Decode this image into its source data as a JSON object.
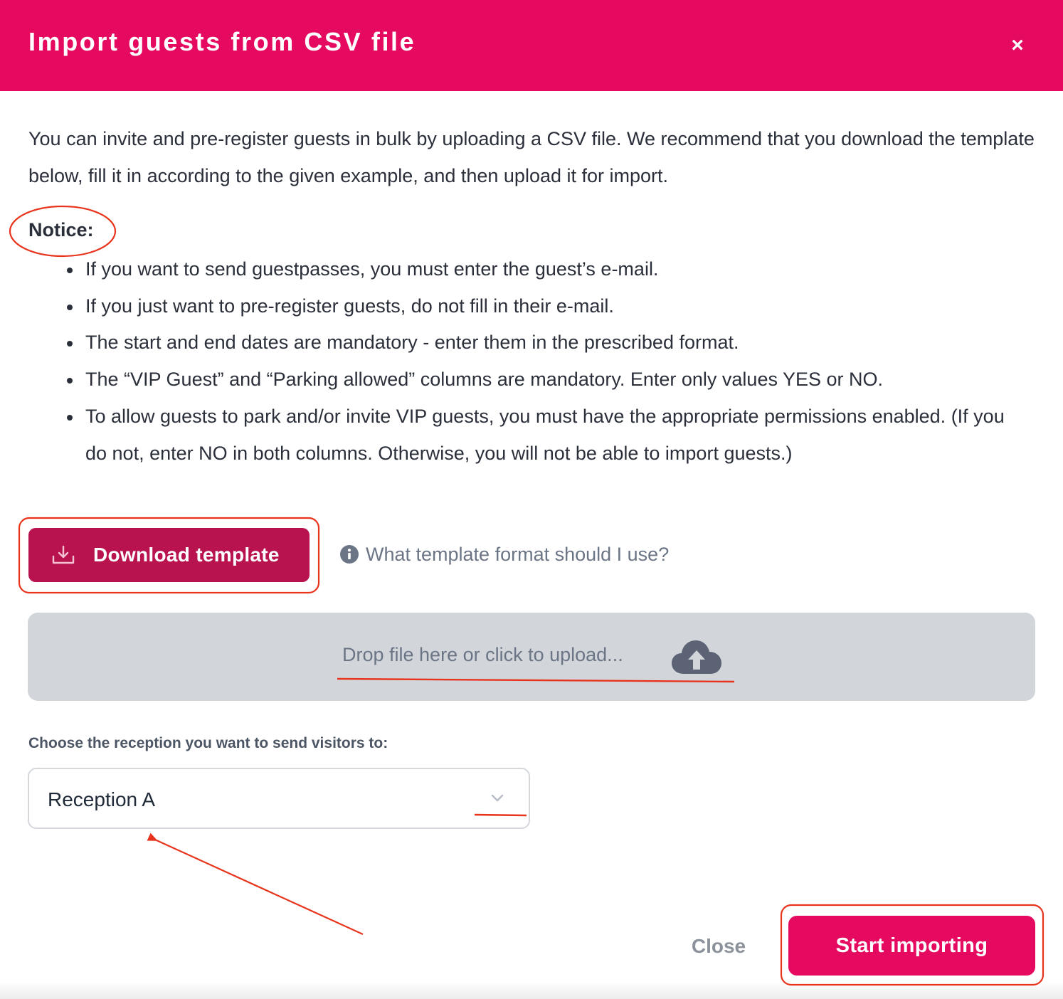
{
  "dialog": {
    "title": "Import guests from CSV file",
    "close_icon": "close-icon",
    "close_glyph": "×"
  },
  "intro": {
    "text": "You can invite and pre-register guests in bulk by uploading a CSV file. We recommend that you download the template below, fill it in according to the given example, and then upload it for import."
  },
  "notice": {
    "label": "Notice:",
    "items": [
      "If you want to send guestpasses, you must enter the guest’s e-mail.",
      "If you just want to pre-register guests, do not fill in their e-mail.",
      "The start and end dates are mandatory - enter them in the prescribed format.",
      "The “VIP Guest” and “Parking allowed” columns are mandatory. Enter only values YES or NO.",
      "To allow guests to park and/or invite VIP guests, you must have the appropriate permissions enabled. (If you do not, enter NO in both columns. Otherwise, you will not be able to import guests.)"
    ]
  },
  "download": {
    "label": "Download template",
    "icon": "download-icon"
  },
  "help": {
    "label": "What template format should I use?",
    "icon": "info-icon"
  },
  "dropzone": {
    "label": "Drop file here or click to upload...",
    "icon": "cloud-upload-icon"
  },
  "reception": {
    "label": "Choose the reception you want to send visitors to:",
    "selected": "Reception A",
    "icon": "chevron-down-icon"
  },
  "footer": {
    "close_label": "Close",
    "start_label": "Start importing"
  },
  "colors": {
    "header": "#e5095f",
    "download_button": "#b8124f",
    "start_button": "#e5095f",
    "dropzone": "#d2d6db",
    "annotation": "#e8341c"
  }
}
